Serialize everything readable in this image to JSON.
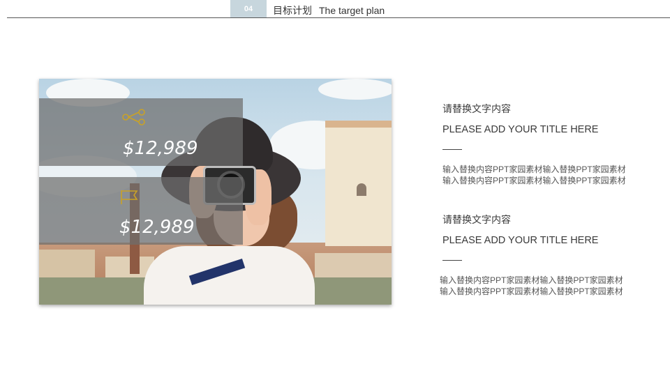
{
  "header": {
    "section_number": "04",
    "title_cn": "目标计划",
    "title_en": "The target plan"
  },
  "stats": [
    {
      "icon": "share-icon",
      "value": "$12,989"
    },
    {
      "icon": "flag-icon",
      "value": "$12,989"
    }
  ],
  "content_blocks": [
    {
      "subtitle": "请替换文字内容",
      "title": "PLEASE ADD YOUR TITLE HERE",
      "body": "输入替换内容PPT家园素材输入替换PPT家园素材输入替换内容PPT家园素材输入替换PPT家园素材"
    },
    {
      "subtitle": "请替换文字内容",
      "title": "PLEASE ADD YOUR TITLE HERE",
      "body": "输入替换内容PPT家园素材输入替换PPT家园素材输入替换内容PPT家园素材输入替换PPT家园素材"
    }
  ],
  "colors": {
    "section_badge": "#c7d6dd",
    "overlay": "#6e6e6e",
    "icon_gold": "#c9a227",
    "text": "#3a3a3a"
  }
}
